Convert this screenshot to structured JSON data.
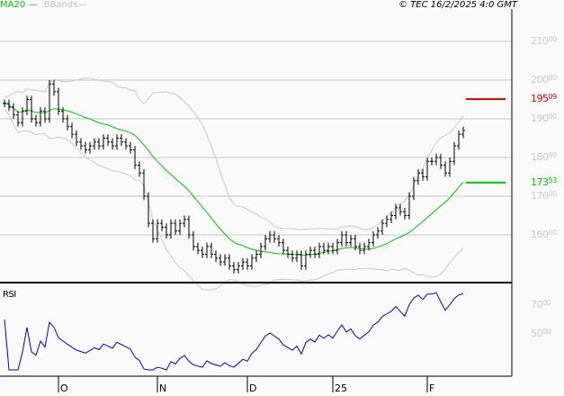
{
  "chart_data": {
    "type": "bar",
    "subtype": "ohlc",
    "title": "",
    "copyright": "© TEC 16/2/2025 4:0 GMT",
    "legend": [
      {
        "name": "MA20",
        "color": "#00c000"
      },
      {
        "name": "BBands",
        "color": "#c0c0c0"
      }
    ],
    "price_axis": {
      "ylim": [
        150,
        210
      ],
      "ticks": [
        {
          "int": "210",
          "dec": "00",
          "v": 210
        },
        {
          "int": "200",
          "dec": "00",
          "v": 200
        },
        {
          "int": "190",
          "dec": "00",
          "v": 190
        },
        {
          "int": "180",
          "dec": "00",
          "v": 180
        },
        {
          "int": "170",
          "dec": "00",
          "v": 170
        },
        {
          "int": "160",
          "dec": "00",
          "v": 160
        }
      ]
    },
    "last_price": {
      "int": "195",
      "dec": "09",
      "v": 195.09,
      "color": "#cc0000"
    },
    "last_ma": {
      "int": "173",
      "dec": "53",
      "v": 173.53,
      "color": "#00c000"
    },
    "rsi": {
      "label": "RSI",
      "period": 14,
      "ylim": [
        25,
        90
      ],
      "ticks": [
        {
          "int": "70",
          "dec": "00",
          "v": 70
        },
        {
          "int": "50",
          "dec": "00",
          "v": 50
        }
      ],
      "color": "#0000cc"
    },
    "x_ticks": [
      {
        "label": "O",
        "i": 12
      },
      {
        "label": "N",
        "i": 34
      },
      {
        "label": "D",
        "i": 54
      },
      {
        "label": "25",
        "i": 73
      },
      {
        "label": "F",
        "i": 94
      }
    ],
    "closes": [
      194,
      193,
      191,
      189,
      192,
      195,
      190,
      189,
      192,
      190,
      199,
      197,
      192,
      190,
      188,
      186,
      184,
      183,
      182,
      183,
      184,
      183,
      185,
      184,
      183,
      185,
      184,
      183,
      182,
      178,
      176,
      170,
      163,
      159,
      163,
      162,
      160,
      163,
      161,
      163,
      164,
      160,
      157,
      156,
      155,
      157,
      155,
      154,
      153,
      154,
      152,
      151,
      152,
      153,
      152,
      154,
      155,
      157,
      159,
      160,
      159,
      158,
      156,
      155,
      154,
      155,
      152,
      155,
      156,
      155,
      157,
      156,
      157,
      156,
      158,
      160,
      158,
      159,
      157,
      156,
      157,
      158,
      160,
      161,
      163,
      164,
      165,
      167,
      166,
      165,
      170,
      174,
      176,
      175,
      179,
      179,
      180,
      178,
      176,
      179,
      183,
      186,
      187
    ]
  }
}
